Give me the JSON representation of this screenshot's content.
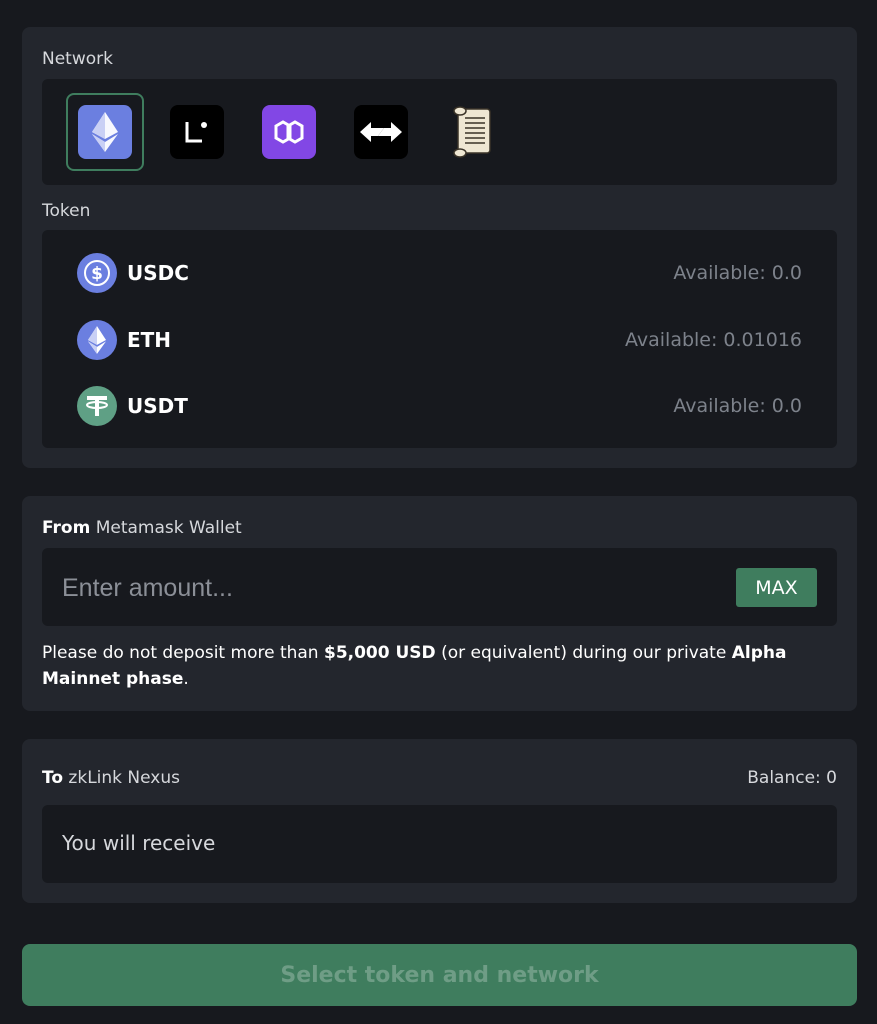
{
  "network_section": {
    "label": "Network",
    "networks": [
      {
        "icon": "ethereum-icon",
        "selected": true
      },
      {
        "icon": "linea-icon",
        "selected": false
      },
      {
        "icon": "polygon-icon",
        "selected": false
      },
      {
        "icon": "swap-arrows-icon",
        "selected": false
      },
      {
        "icon": "scroll-icon",
        "selected": false
      }
    ]
  },
  "token_section": {
    "label": "Token",
    "tokens": [
      {
        "symbol": "USDC",
        "available": "Available: 0.0",
        "icon": "usdc-icon",
        "color": "#6b7fe0"
      },
      {
        "symbol": "ETH",
        "available": "Available: 0.01016",
        "icon": "eth-icon",
        "color": "#6b7fe0"
      },
      {
        "symbol": "USDT",
        "available": "Available: 0.0",
        "icon": "usdt-icon",
        "color": "#5fa085"
      }
    ]
  },
  "from_section": {
    "label_bold": "From",
    "label_rest": " Metamask Wallet",
    "amount_placeholder": "Enter amount...",
    "max_label": "MAX",
    "notice": {
      "part1": "Please do not deposit more than ",
      "bold1": "$5,000 USD",
      "part2": " (or equivalent) during our private ",
      "bold2": "Alpha Mainnet phase",
      "part3": "."
    }
  },
  "to_section": {
    "label_bold": "To",
    "label_rest": " zkLink Nexus",
    "balance": "Balance: 0",
    "receive_text": "You will receive"
  },
  "submit": {
    "label": "Select token and network"
  },
  "colors": {
    "accent": "#3f7d5e",
    "card_bg": "#23262d",
    "inner_bg": "#17191e"
  }
}
